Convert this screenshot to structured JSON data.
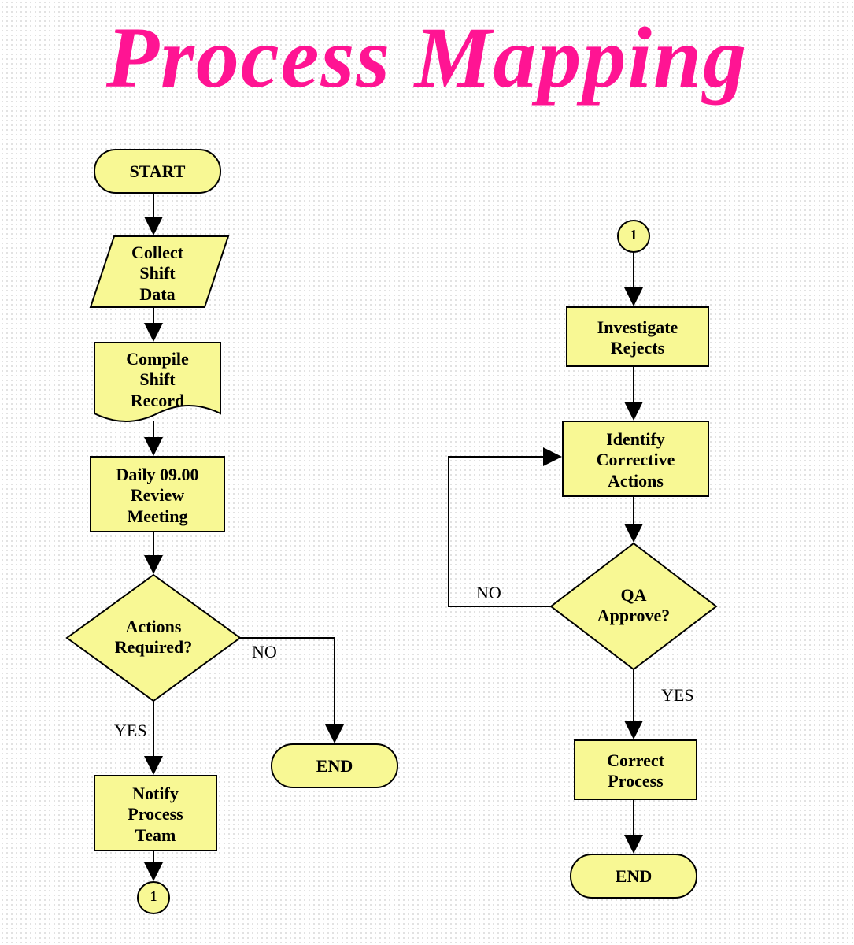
{
  "title": "Process Mapping",
  "nodes": {
    "start": {
      "text": "START"
    },
    "collect": {
      "text": "Collect\nShift\nData"
    },
    "compile": {
      "text": "Compile\nShift\nRecord"
    },
    "review": {
      "text": "Daily 09.00\nReview\nMeeting"
    },
    "actions": {
      "text": "Actions\nRequired?"
    },
    "notify": {
      "text": "Notify\nProcess\nTeam"
    },
    "end1": {
      "text": "END"
    },
    "conn1a": {
      "text": "1"
    },
    "conn1b": {
      "text": "1"
    },
    "investigate": {
      "text": "Investigate\nRejects"
    },
    "identify": {
      "text": "Identify\nCorrective\nActions"
    },
    "qa": {
      "text": "QA\nApprove?"
    },
    "correct": {
      "text": "Correct\nProcess"
    },
    "end2": {
      "text": "END"
    }
  },
  "edges": {
    "actions_yes": "YES",
    "actions_no": "NO",
    "qa_yes": "YES",
    "qa_no": "NO"
  }
}
